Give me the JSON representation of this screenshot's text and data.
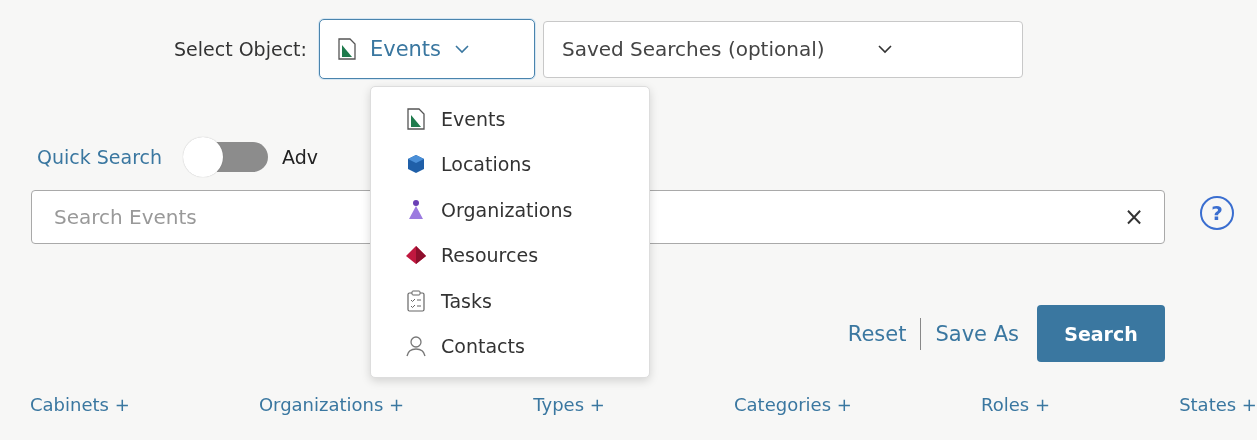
{
  "object_select": {
    "label": "Select Object:",
    "value": "Events",
    "expanded": true
  },
  "saved_searches": {
    "placeholder": "Saved Searches (optional)"
  },
  "mode": {
    "quick_label": "Quick Search",
    "advanced_on": false,
    "advanced_label": "Adv"
  },
  "object_menu": [
    {
      "label": "Events",
      "kind": "event"
    },
    {
      "label": "Locations",
      "kind": "location"
    },
    {
      "label": "Organizations",
      "kind": "organization"
    },
    {
      "label": "Resources",
      "kind": "resource"
    },
    {
      "label": "Tasks",
      "kind": "task"
    },
    {
      "label": "Contacts",
      "kind": "contact"
    }
  ],
  "search": {
    "placeholder": "Search Events",
    "clear": "×",
    "help": "?"
  },
  "actions": {
    "reset": "Reset",
    "save_as": "Save As",
    "search": "Search"
  },
  "filters": [
    "Cabinets +",
    "Organizations +",
    "Types +",
    "Categories +",
    "Roles +",
    "States +"
  ]
}
